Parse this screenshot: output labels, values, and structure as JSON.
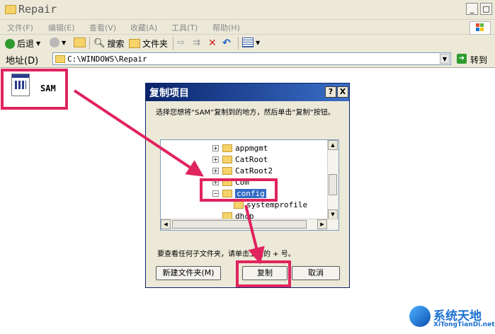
{
  "window": {
    "title": "Repair",
    "btn_min": "_",
    "btn_max": "□",
    "btn_close": "X"
  },
  "menu": [
    "文件(F)",
    "编辑(E)",
    "查看(V)",
    "收藏(A)",
    "工具(T)",
    "帮助(H)"
  ],
  "toolbar": {
    "back": "后退",
    "search": "搜索",
    "folders": "文件夹"
  },
  "address": {
    "label": "地址(D)",
    "path": "C:\\WINDOWS\\Repair",
    "go": "转到"
  },
  "file": {
    "name": "SAM"
  },
  "dialog": {
    "title": "复制项目",
    "help": "?",
    "close": "X",
    "instruction": "选择您想将“SAM”复制到的地方，然后单击“复制”按钮。",
    "tree": [
      {
        "label": "appmgmt",
        "expander": "+"
      },
      {
        "label": "CatRoot",
        "expander": "+"
      },
      {
        "label": "CatRoot2",
        "expander": "+"
      },
      {
        "label": "Com",
        "expander": "+"
      },
      {
        "label": "config",
        "expander": "−",
        "selected": true
      },
      {
        "label": "systemprofile",
        "expander": ""
      },
      {
        "label": "dhcp",
        "expander": ""
      }
    ],
    "footer_text": "要查看任何子文件夹，请单击上面的 + 号。",
    "new_folder": "新建文件夹(M)",
    "copy": "复制",
    "cancel": "取消"
  },
  "watermark": {
    "title": "系统天地",
    "url": "XiTongTianDi.net"
  },
  "colors": {
    "highlight": "#e0245e",
    "dialog_title": "#0a246a",
    "selection": "#316ac5"
  }
}
